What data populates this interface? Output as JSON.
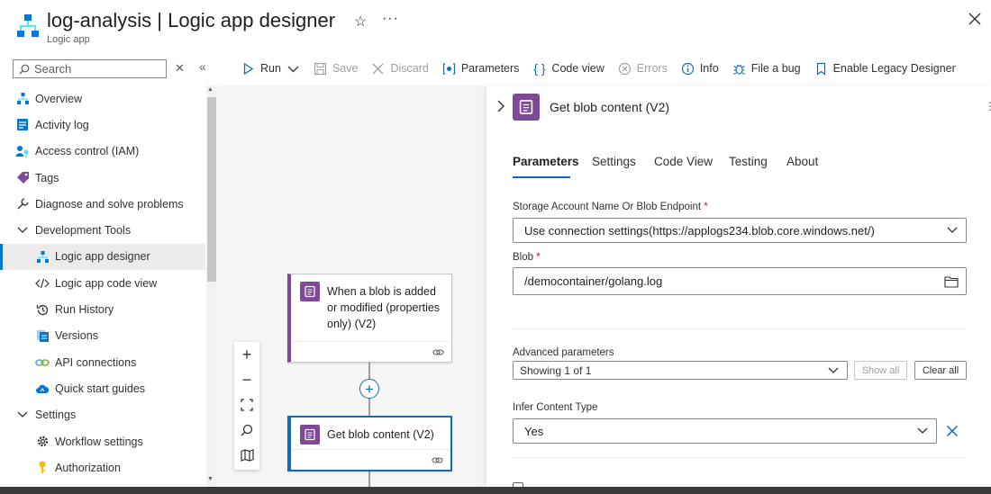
{
  "header": {
    "title": "log-analysis | Logic app designer",
    "subtitle": "Logic app",
    "favorite_icon": "star-outline-icon",
    "more_icon": "ellipsis-icon",
    "close_icon": "close-icon"
  },
  "search": {
    "placeholder": "Search"
  },
  "sidebar": {
    "items": [
      {
        "label": "Overview",
        "icon": "overview-icon"
      },
      {
        "label": "Activity log",
        "icon": "activity-log-icon"
      },
      {
        "label": "Access control (IAM)",
        "icon": "access-control-icon"
      },
      {
        "label": "Tags",
        "icon": "tag-icon"
      },
      {
        "label": "Diagnose and solve problems",
        "icon": "wrench-icon"
      },
      {
        "label": "Development Tools",
        "icon": "chevron-down-icon"
      },
      {
        "label": "Logic app designer",
        "icon": "designer-icon"
      },
      {
        "label": "Logic app code view",
        "icon": "code-icon"
      },
      {
        "label": "Run History",
        "icon": "history-icon"
      },
      {
        "label": "Versions",
        "icon": "versions-icon"
      },
      {
        "label": "API connections",
        "icon": "link-icon"
      },
      {
        "label": "Quick start guides",
        "icon": "cloud-icon"
      },
      {
        "label": "Settings",
        "icon": "chevron-down-icon"
      },
      {
        "label": "Workflow settings",
        "icon": "gear-icon"
      },
      {
        "label": "Authorization",
        "icon": "key-icon"
      }
    ]
  },
  "toolbar": {
    "run": "Run",
    "save": "Save",
    "discard": "Discard",
    "parameters": "Parameters",
    "code_view": "Code view",
    "errors": "Errors",
    "info": "Info",
    "file_bug": "File a bug",
    "legacy": "Enable Legacy Designer"
  },
  "canvas": {
    "trigger_title": "When a blob is added or modified (properties only) (V2)",
    "action_title": "Get blob content (V2)",
    "add_step": "+",
    "zoom_in": "+",
    "zoom_out": "−"
  },
  "panel": {
    "title": "Get blob content (V2)",
    "tabs": [
      "Parameters",
      "Settings",
      "Code View",
      "Testing",
      "About"
    ],
    "connection_label": "Storage Account Name Or Blob Endpoint",
    "connection_value": "Use connection settings(https://applogs234.blob.core.windows.net/)",
    "blob_label": "Blob",
    "blob_value": "/democontainer/golang.log",
    "required_mark": "*",
    "advanced_label": "Advanced parameters",
    "advanced_value": "Showing 1 of 1",
    "show_all": "Show all",
    "clear_all": "Clear all",
    "infer_label": "Infer Content Type",
    "infer_value": "Yes"
  },
  "colors": {
    "accent": "#0f6cbd",
    "connector_purple": "#804998",
    "active_nav": "#0078d4"
  }
}
